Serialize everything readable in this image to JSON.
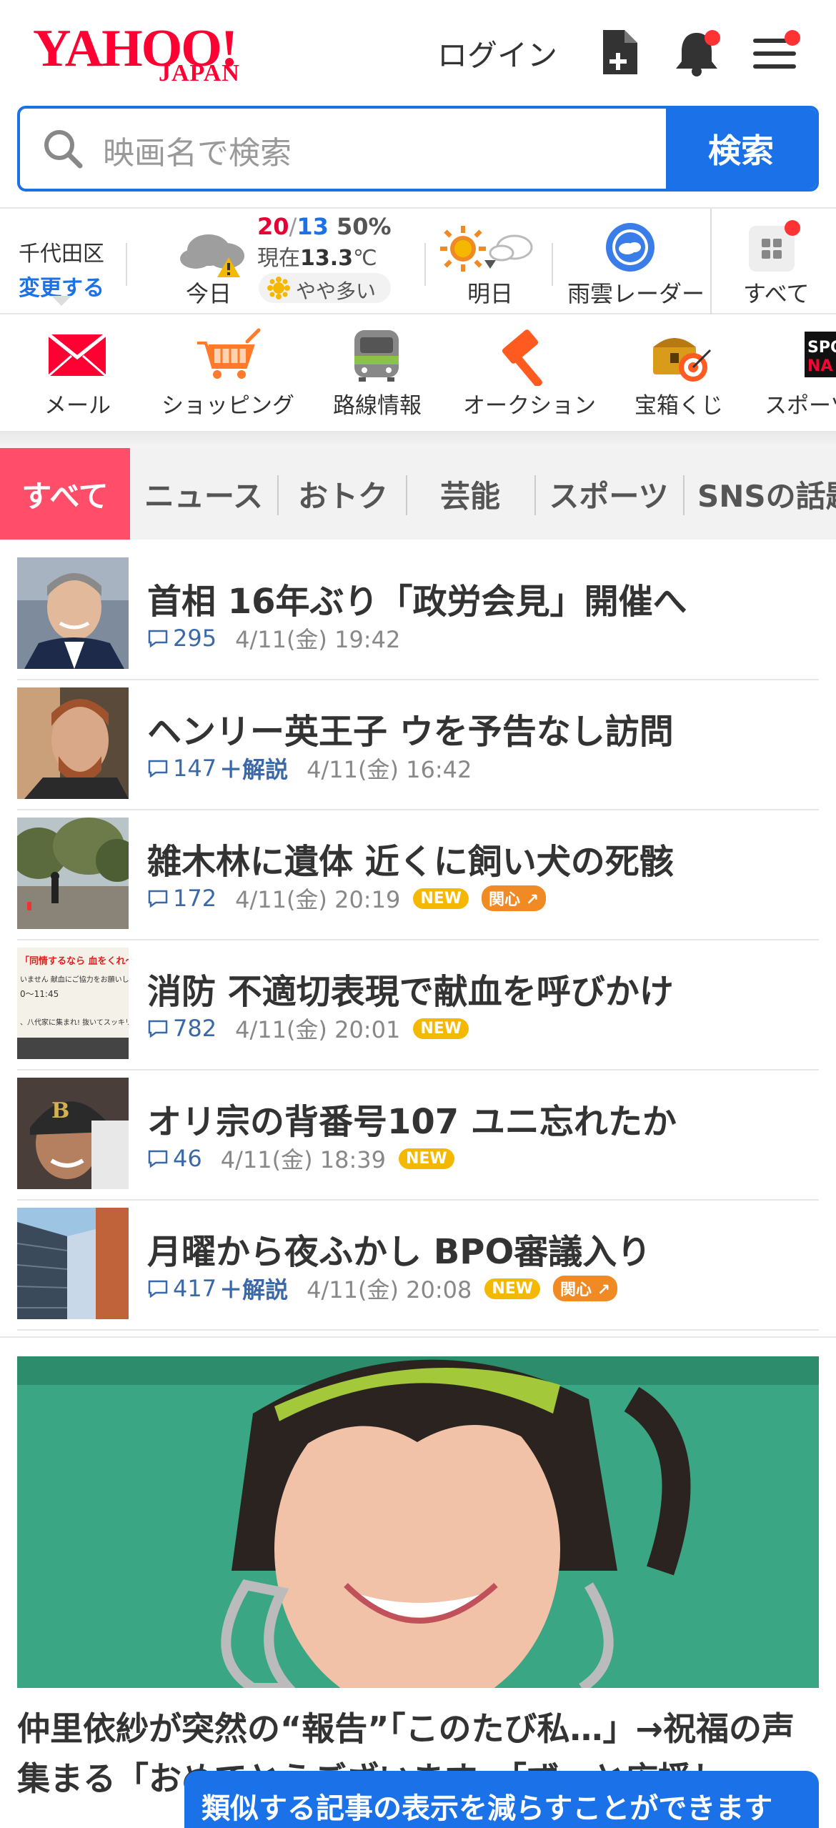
{
  "header": {
    "logo_text": "YAHOO!",
    "logo_sub": "JAPAN",
    "login_label": "ログイン",
    "icons": [
      "add-document-icon",
      "bell-icon",
      "hamburger-menu-icon"
    ]
  },
  "search": {
    "placeholder": "映画名で検索",
    "button_label": "検索"
  },
  "weather": {
    "area": "千代田区",
    "change_label": "変更する",
    "today_label": "今日",
    "high": "20",
    "slash": "/",
    "low": "13",
    "rain": "50%",
    "now_prefix": "現在",
    "now_temp": "13.3",
    "now_unit": "℃",
    "pollen": "やや多い",
    "tomorrow_label": "明日",
    "radar_label": "雨雲レーダー",
    "all_label": "すべて"
  },
  "services": [
    {
      "label": "メール",
      "icon": "mail-icon"
    },
    {
      "label": "ショッピング",
      "icon": "shopping-cart-icon"
    },
    {
      "label": "路線情報",
      "icon": "train-icon"
    },
    {
      "label": "オークション",
      "icon": "auction-hammer-icon"
    },
    {
      "label": "宝箱くじ",
      "icon": "treasure-box-icon"
    },
    {
      "label": "スポーツ",
      "icon": "sports-icon"
    }
  ],
  "tabs": [
    "すべて",
    "ニュース",
    "おトク",
    "芸能",
    "スポーツ",
    "SNSの話題"
  ],
  "news": [
    {
      "title": "首相 16年ぶり「政労会見」開催へ",
      "comments": "295",
      "kaisetsu": "",
      "time": "4/11(金) 19:42",
      "new": "",
      "kanshin": ""
    },
    {
      "title": "ヘンリー英王子 ウを予告なし訪問",
      "comments": "147",
      "kaisetsu": "＋解説",
      "time": "4/11(金) 16:42",
      "new": "",
      "kanshin": ""
    },
    {
      "title": "雑木林に遺体 近くに飼い犬の死骸",
      "comments": "172",
      "kaisetsu": "",
      "time": "4/11(金) 20:19",
      "new": "NEW",
      "kanshin": "関心"
    },
    {
      "title": "消防 不適切表現で献血を呼びかけ",
      "comments": "782",
      "kaisetsu": "",
      "time": "4/11(金) 20:01",
      "new": "NEW",
      "kanshin": ""
    },
    {
      "title": "オリ宗の背番号107 ユニ忘れたか",
      "comments": "46",
      "kaisetsu": "",
      "time": "4/11(金) 18:39",
      "new": "NEW",
      "kanshin": ""
    },
    {
      "title": "月曜から夜ふかし BPO審議入り",
      "comments": "417",
      "kaisetsu": "＋解説",
      "time": "4/11(金) 20:08",
      "new": "NEW",
      "kanshin": "関心"
    }
  ],
  "thumb3_text": {
    "line1": "「同情するなら 血をくれ～」",
    "line2": "いません 献血にご協力をお願いします。",
    "line3": "0～11:45",
    "line4": "、八代家に集まれ! 抜いてスッキリしよ～!"
  },
  "hero": {
    "title": "仲里依紗が突然の“報告”「このたび私…」→祝福の声集まる「おめでとうございます」「ずっと応援し"
  },
  "toast": {
    "text": "類似する記事の表示を減らすことができます"
  },
  "colors": {
    "brand_red": "#ff0033",
    "accent_blue": "#1b72e8",
    "tab_active": "#ff4d6a",
    "new_badge": "#f5b800"
  }
}
